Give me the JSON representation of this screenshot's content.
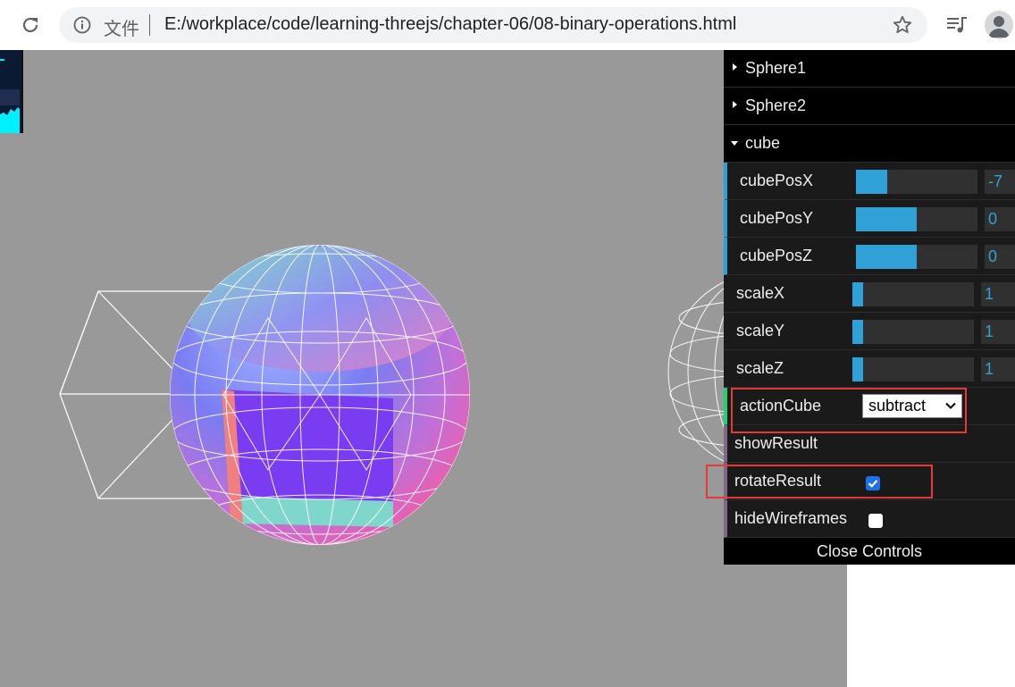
{
  "browser": {
    "scheme_label": "文件",
    "url": "E:/workplace/code/learning-threejs/chapter-06/08-binary-operations.html"
  },
  "gui": {
    "folders": [
      {
        "title": "Sphere1"
      },
      {
        "title": "Sphere2"
      },
      {
        "title": "cube"
      }
    ],
    "controls": [
      {
        "label": "cubePosX",
        "value": "-7",
        "fill": 0.26
      },
      {
        "label": "cubePosY",
        "value": "0",
        "fill": 0.5
      },
      {
        "label": "cubePosZ",
        "value": "0",
        "fill": 0.5
      },
      {
        "label": "scaleX",
        "value": "1",
        "fill": 0.09
      },
      {
        "label": "scaleY",
        "value": "1",
        "fill": 0.09
      },
      {
        "label": "scaleZ",
        "value": "1",
        "fill": 0.09
      }
    ],
    "actionCube": {
      "label": "actionCube",
      "value": "subtract"
    },
    "showResult": {
      "label": "showResult"
    },
    "rotateResult": {
      "label": "rotateResult",
      "checked": true
    },
    "hideWireframes": {
      "label": "hideWireframes",
      "checked": false
    },
    "close_label": "Close Controls"
  },
  "colors": {
    "viewport_bg": "#999999",
    "slider_fill": "#2fa1d6",
    "highlight": "#e53935"
  }
}
